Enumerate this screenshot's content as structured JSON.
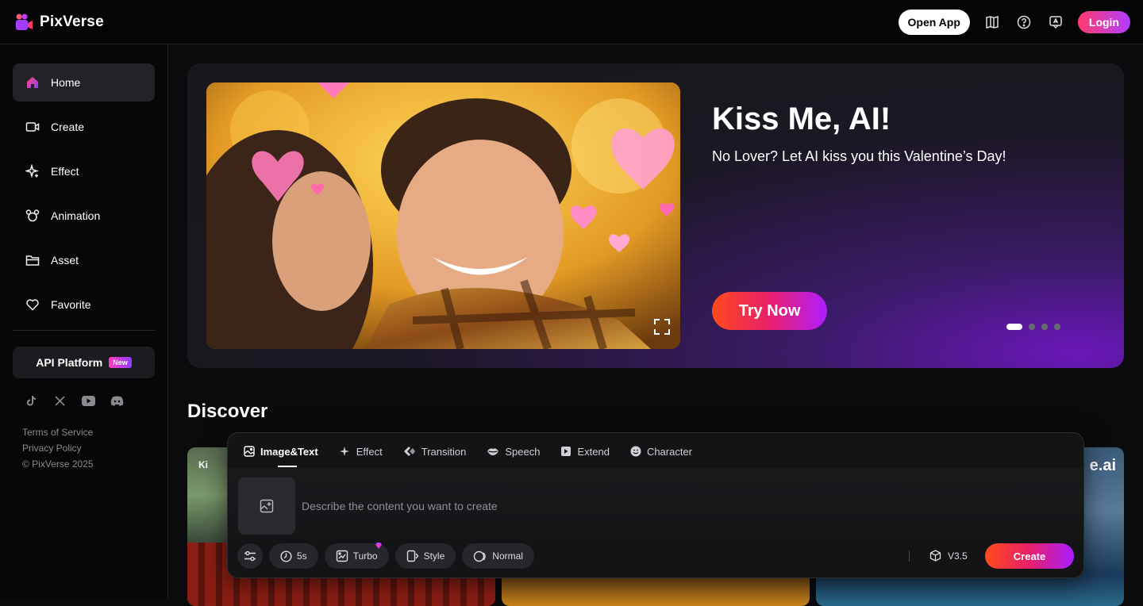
{
  "app": {
    "name": "PixVerse"
  },
  "header": {
    "open_app": "Open App",
    "login": "Login",
    "icons": [
      "book-icon",
      "help-icon",
      "feedback-icon"
    ]
  },
  "sidebar": {
    "items": [
      {
        "label": "Home",
        "icon": "home-icon",
        "active": true
      },
      {
        "label": "Create",
        "icon": "video-camera-icon"
      },
      {
        "label": "Effect",
        "icon": "sparkle-icon"
      },
      {
        "label": "Animation",
        "icon": "mouse-ears-icon"
      },
      {
        "label": "Asset",
        "icon": "folder-icon"
      },
      {
        "label": "Favorite",
        "icon": "heart-icon"
      }
    ],
    "api_platform": "API Platform",
    "api_badge": "New",
    "social": [
      "tiktok-icon",
      "x-icon",
      "youtube-icon",
      "discord-icon"
    ],
    "terms": "Terms of Service",
    "privacy": "Privacy Policy",
    "copyright": "© PixVerse 2025"
  },
  "hero": {
    "title": "Kiss Me, AI!",
    "subtitle": "No Lover? Let AI kiss you this Valentine’s Day!",
    "cta": "Try Now",
    "slides": 4,
    "current_slide": 1
  },
  "discover": {
    "title": "Discover",
    "card_texts": [
      "Ki",
      "e.ai"
    ]
  },
  "composer": {
    "tabs": [
      {
        "label": "Image&Text",
        "icon": "image-icon",
        "active": true
      },
      {
        "label": "Effect",
        "icon": "sparkle-icon"
      },
      {
        "label": "Transition",
        "icon": "transition-icon"
      },
      {
        "label": "Speech",
        "icon": "lips-icon"
      },
      {
        "label": "Extend",
        "icon": "extend-icon"
      },
      {
        "label": "Character",
        "icon": "smile-icon"
      }
    ],
    "placeholder": "Describe the content you want to create",
    "duration": "5s",
    "turbo": "Turbo",
    "style": "Style",
    "mode": "Normal",
    "version": "V3.5",
    "create": "Create"
  },
  "colors": {
    "accent_start": "#ff4a1c",
    "accent_end": "#b01cff"
  }
}
